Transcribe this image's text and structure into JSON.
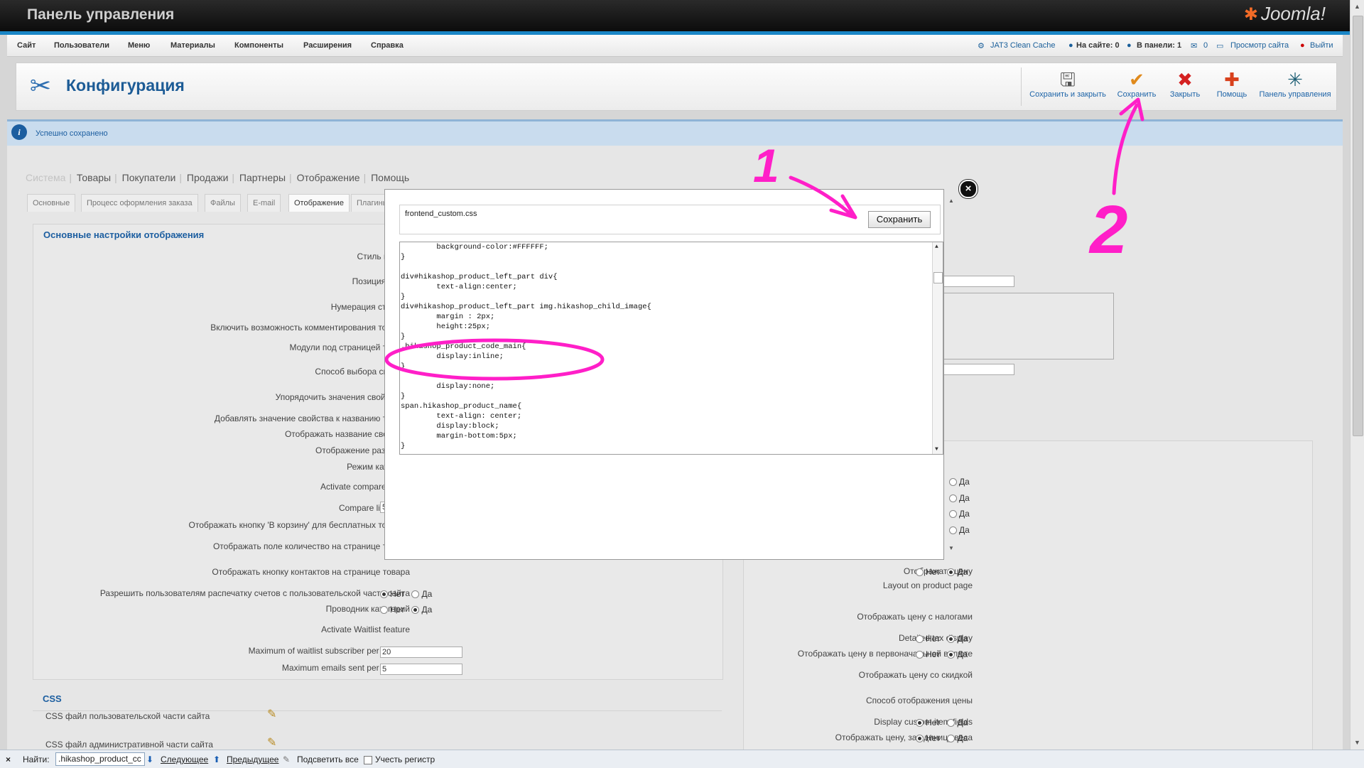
{
  "header": {
    "title": "Панель управления",
    "logo": "Joomla!"
  },
  "menu": {
    "items": [
      "Сайт",
      "Пользователи",
      "Меню",
      "Материалы",
      "Компоненты",
      "Расширения",
      "Справка"
    ],
    "status": {
      "cache": "JAT3 Clean Cache",
      "on_site": "На сайте: 0",
      "in_panel": "В панели: 1",
      "messages": "0",
      "view_site": "Просмотр сайта",
      "logout": "Выйти"
    }
  },
  "toolbar": {
    "title": "Конфигурация",
    "buttons": [
      "Сохранить и закрыть",
      "Сохранить",
      "Закрыть",
      "Помощь",
      "Панель управления"
    ]
  },
  "message": "Успешно сохранено",
  "main_tabs": [
    "Система",
    "Товары",
    "Покупатели",
    "Продажи",
    "Партнеры",
    "Отображение",
    "Помощь"
  ],
  "sub_tabs": [
    "Основные",
    "Процесс оформления заказа",
    "Файлы",
    "E-mail",
    "Отображение",
    "Плагины"
  ],
  "display_panel": {
    "title": "Основные настройки отображения",
    "labels": [
      "Стиль кнопки",
      "Позиция меню",
      "Нумерация страниц",
      "Включить возможность комментирования товаров",
      "Модули под страницей товара",
      "Способ выбора свойств",
      "Упорядочить значения свойств по",
      "Добавлять значение свойства к названию товара",
      "Отображать название свойства",
      "Отображение размеров",
      "Режим каталога",
      "Activate compare mode",
      "Compare limitation",
      "Отображать кнопку 'В корзину' для бесплатных товаров",
      "Отображать поле количество на странице товара",
      "Отображать кнопку контактов на странице товара",
      "Разрешить пользователям распечатку счетов с пользовательской части сайта",
      "Проводник категорий",
      "Activate Waitlist feature",
      "Maximum of waitlist subscriber per product",
      "Maximum emails sent per product"
    ],
    "compare_limit_value": "5",
    "waitlist_max": "20",
    "emails_max": "5",
    "no": "Нет",
    "yes": "Да"
  },
  "css_panel": {
    "title": "CSS",
    "labels": [
      "CSS файл пользовательской части сайта",
      "CSS файл административной части сайта"
    ]
  },
  "right_panel": {
    "labels": [
      "Отображать цену",
      "Layout on product page",
      "Отображать цену с налогами",
      "Detailed tax display",
      "Отображать цену в первоначальной валюте",
      "Отображать цену со скидкой",
      "Способ отображения цены",
      "Display custom item fields",
      "Отображать цену, за единицу веса"
    ]
  },
  "modal": {
    "filename": "frontend_custom.css",
    "save_label": "Сохранить",
    "code_lines": [
      "        background-color:#FFFFFF;",
      "}",
      "",
      "div#hikashop_product_left_part div{",
      "        text-align:center;",
      "}",
      "div#hikashop_product_left_part img.hikashop_child_image{",
      "        margin : 2px;",
      "        height:25px;",
      "}",
      ".hikashop_product_code_main{",
      "        display:inline;",
      "}",
      "",
      "        display:none;",
      "}",
      "span.hikashop_product_name{",
      "        text-align: center;",
      "        display:block;",
      "        margin-bottom:5px;",
      "}"
    ]
  },
  "annotations": {
    "step1": "1",
    "step2": "2",
    "color": "#ff1fc8"
  },
  "findbar": {
    "label": "Найти:",
    "query": ".hikashop_product_cc",
    "next": "Следующее",
    "prev": "Предыдущее",
    "highlight": "Подсветить все",
    "match_case": "Учесть регистр"
  }
}
